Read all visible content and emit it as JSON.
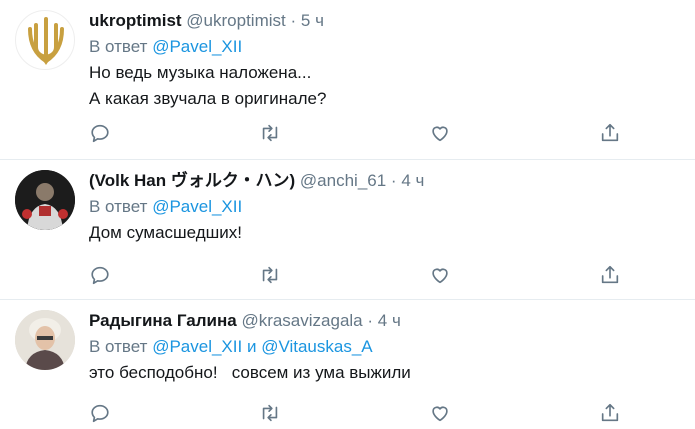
{
  "tweets": [
    {
      "display_name": "ukroptimist",
      "handle": "@ukroptimist",
      "separator": "·",
      "time": "5 ч",
      "reply_prefix": "В ответ",
      "reply_to": [
        "@Pavel_XII"
      ],
      "reply_joiner": "",
      "text": "Но ведь музыка наложена...\nА какая звучала в оригинале?"
    },
    {
      "display_name": "(Volk Han ヴォルク・ハン)",
      "handle": "@anchi_61",
      "separator": "·",
      "time": "4 ч",
      "reply_prefix": "В ответ",
      "reply_to": [
        "@Pavel_XII"
      ],
      "reply_joiner": "",
      "text": "Дом сумасшедших!"
    },
    {
      "display_name": "Радыгина Галина",
      "handle": "@krasavizagala",
      "separator": "·",
      "time": "4 ч",
      "reply_prefix": "В ответ",
      "reply_to": [
        "@Pavel_XII",
        "@Vitauskas_A"
      ],
      "reply_joiner": "и",
      "text": "это бесподобно!   совсем из ума выжили"
    }
  ],
  "icons": {
    "reply": "reply-icon",
    "retweet": "retweet-icon",
    "like": "heart-icon",
    "share": "share-icon"
  },
  "colors": {
    "link": "#1b95e0",
    "muted": "#657786",
    "text": "#14171a",
    "divider": "#e6ecf0"
  }
}
